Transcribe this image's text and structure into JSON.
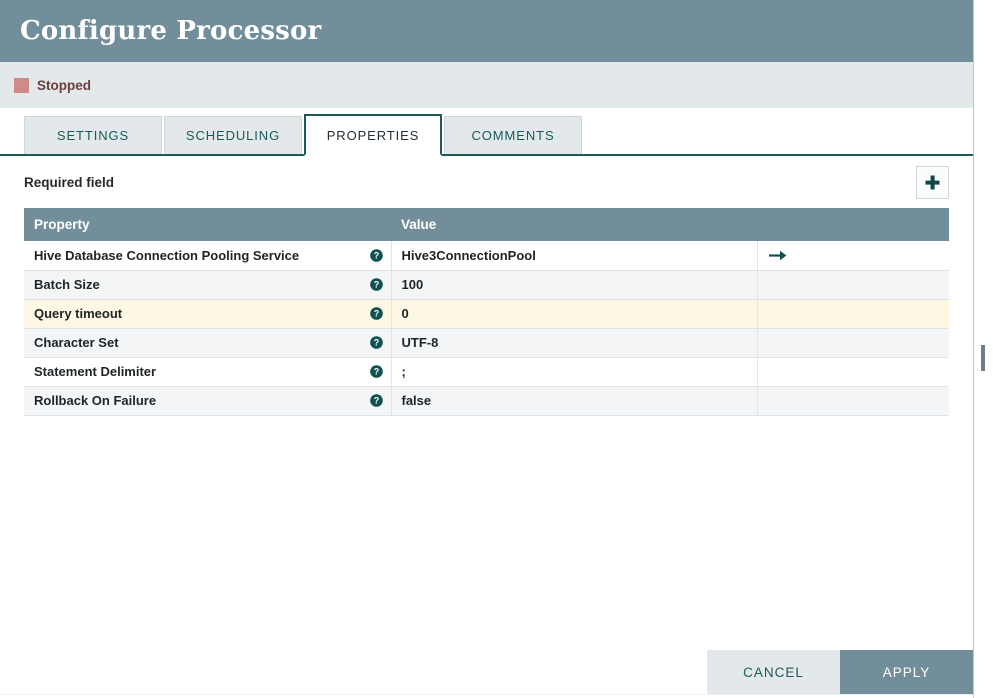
{
  "dialog": {
    "title": "Configure Processor",
    "status": {
      "label": "Stopped",
      "color": "#cf8a8a"
    },
    "tabs": [
      {
        "label": "SETTINGS",
        "active": false
      },
      {
        "label": "SCHEDULING",
        "active": false
      },
      {
        "label": "PROPERTIES",
        "active": true
      },
      {
        "label": "COMMENTS",
        "active": false
      }
    ],
    "required_field_label": "Required field",
    "add_property_icon": "plus-icon",
    "table": {
      "columns": [
        "Property",
        "Value",
        ""
      ],
      "rows": [
        {
          "property": "Hive Database Connection Pooling Service",
          "help_icon": "help-circle-icon",
          "value": "Hive3ConnectionPool",
          "action_icon": "arrow-right-icon",
          "selected": false
        },
        {
          "property": "Batch Size",
          "help_icon": "help-circle-icon",
          "value": "100",
          "action_icon": "",
          "selected": false
        },
        {
          "property": "Query timeout",
          "help_icon": "help-circle-icon",
          "value": "0",
          "action_icon": "",
          "selected": true
        },
        {
          "property": "Character Set",
          "help_icon": "help-circle-icon",
          "value": "UTF-8",
          "action_icon": "",
          "selected": false
        },
        {
          "property": "Statement Delimiter",
          "help_icon": "help-circle-icon",
          "value": ";",
          "action_icon": "",
          "selected": false
        },
        {
          "property": "Rollback On Failure",
          "help_icon": "help-circle-icon",
          "value": "false",
          "action_icon": "",
          "selected": false
        }
      ]
    },
    "footer": {
      "cancel_label": "CANCEL",
      "apply_label": "APPLY"
    },
    "colors": {
      "header": "#728e9b",
      "accent_teal": "#1c5b5b",
      "status_stopped": "#cf8a8a",
      "selected_row": "#fdf8e3"
    }
  }
}
